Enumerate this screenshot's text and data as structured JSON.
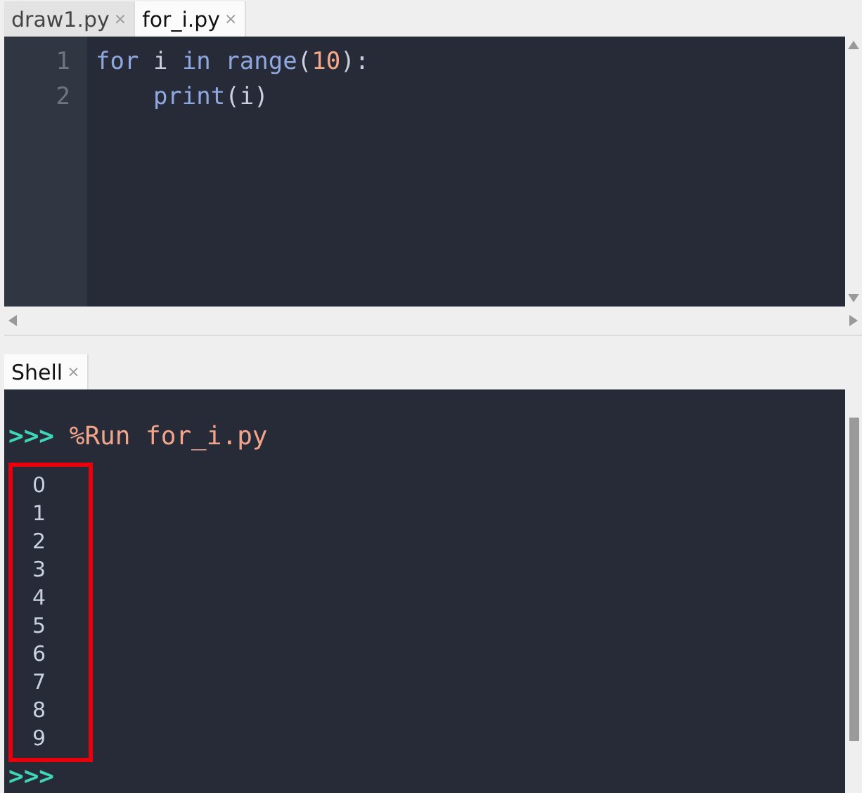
{
  "editor_tabs": [
    {
      "label": "draw1.py",
      "close": "×",
      "selected": false
    },
    {
      "label": "for_i.py",
      "close": "×",
      "selected": true
    }
  ],
  "editor": {
    "lines": [
      {
        "number": "1",
        "tokens": [
          {
            "text": "for",
            "kind": "keyword"
          },
          {
            "text": " i ",
            "kind": "name"
          },
          {
            "text": "in",
            "kind": "keyword"
          },
          {
            "text": " range",
            "kind": "builtin"
          },
          {
            "text": "(",
            "kind": "punct"
          },
          {
            "text": "10",
            "kind": "number"
          },
          {
            "text": "):",
            "kind": "punct"
          }
        ]
      },
      {
        "number": "2",
        "tokens": [
          {
            "text": "    print",
            "kind": "builtin"
          },
          {
            "text": "(i)",
            "kind": "punct"
          }
        ]
      }
    ]
  },
  "shell_tab": {
    "label": "Shell",
    "close": "×",
    "selected": true
  },
  "shell": {
    "prompt": ">>>",
    "command": "%Run for_i.py",
    "output": [
      "0",
      "1",
      "2",
      "3",
      "4",
      "5",
      "6",
      "7",
      "8",
      "9"
    ],
    "highlighted": true,
    "next_prompt": ">>>"
  }
}
